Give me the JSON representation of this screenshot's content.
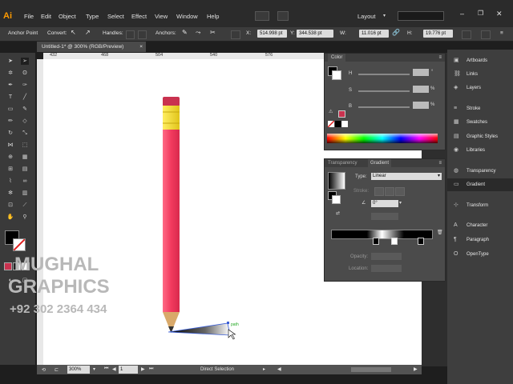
{
  "app": {
    "logo": "Ai",
    "workspace": "Layout"
  },
  "menu": [
    "File",
    "Edit",
    "Object",
    "Type",
    "Select",
    "Effect",
    "View",
    "Window",
    "Help"
  ],
  "control_bar": {
    "anchor_point": "Anchor Point",
    "convert": "Convert:",
    "handles": "Handles:",
    "anchors": "Anchors:",
    "x_label": "X:",
    "x_value": "514.998 pt",
    "y_label": "Y:",
    "y_value": "344.538 pt",
    "w_label": "W:",
    "w_value": "11.016 pt",
    "h_label": "H:",
    "h_value": "19.776 pt"
  },
  "document_tab": "Untitled-1* @ 300% (RGB/Preview)",
  "ruler_ticks": [
    "432",
    "468",
    "504",
    "540",
    "576"
  ],
  "color_panel": {
    "title": "Color",
    "h_label": "H",
    "s_label": "S",
    "b_label": "B",
    "h_unit": "°",
    "s_unit": "%",
    "b_unit": "%"
  },
  "gradient_panel": {
    "tab_transparency": "Transparency",
    "tab_gradient": "Gradient",
    "type_label": "Type:",
    "type_value": "Linear",
    "stroke_label": "Stroke:",
    "angle_value": "0°",
    "opacity_label": "Opacity:",
    "location_label": "Location:"
  },
  "dock": {
    "items": [
      {
        "label": "Artboards",
        "icon": "artboards-icon"
      },
      {
        "label": "Links",
        "icon": "links-icon"
      },
      {
        "label": "Layers",
        "icon": "layers-icon"
      },
      {
        "label": "Stroke",
        "icon": "stroke-icon"
      },
      {
        "label": "Swatches",
        "icon": "swatches-icon"
      },
      {
        "label": "Graphic Styles",
        "icon": "graphic-styles-icon"
      },
      {
        "label": "Libraries",
        "icon": "libraries-icon"
      },
      {
        "label": "Transparency",
        "icon": "transparency-icon"
      },
      {
        "label": "Gradient",
        "icon": "gradient-icon"
      },
      {
        "label": "Transform",
        "icon": "transform-icon"
      },
      {
        "label": "Character",
        "icon": "character-icon"
      },
      {
        "label": "Paragraph",
        "icon": "paragraph-icon"
      },
      {
        "label": "OpenType",
        "icon": "opentype-icon"
      }
    ]
  },
  "status": {
    "zoom": "300%",
    "artboard": "1",
    "tool": "Direct Selection"
  },
  "watermark": {
    "line1": "MUGHAL",
    "line2": "GRAPHICS",
    "line3": "+92 302 2364 434"
  },
  "canvas_hint": "path",
  "colors": {
    "pencil_body": "#f23a5e",
    "pencil_ferrule": "#f2df2a",
    "eraser": "#c9324f",
    "wood": "#d9a96a",
    "accent_orange": "#ff9a00"
  }
}
